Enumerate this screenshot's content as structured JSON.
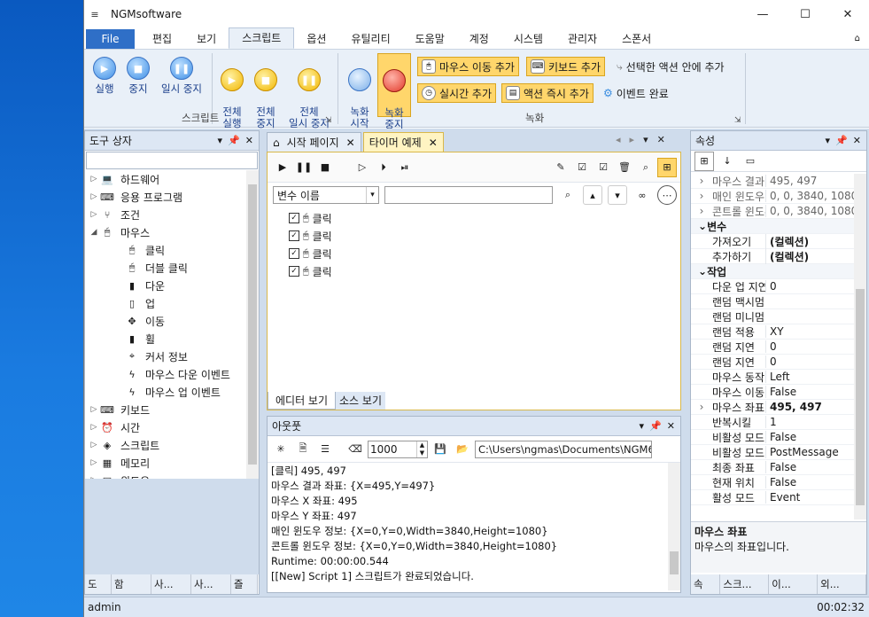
{
  "window": {
    "title": "NGMsoftware",
    "qa_icon": "≡",
    "min": "—",
    "max": "☐",
    "close": "✕"
  },
  "menu": {
    "file": "File",
    "items": [
      "편집",
      "보기",
      "스크립트",
      "옵션",
      "유틸리티",
      "도움말",
      "계정",
      "시스템",
      "관리자",
      "스폰서"
    ],
    "active": "스크립트"
  },
  "ribbon": {
    "run": "실행",
    "stop": "중지",
    "pause": "일시 중지",
    "all_run": "전체\n실행",
    "all_stop": "전체\n중지",
    "all_pause": "전체\n일시 중지",
    "group_script": "스크립트",
    "rec_start": "녹화\n시작",
    "rec_stop": "녹화\n중지",
    "mouse_move_add": "마우스 이동 추가",
    "keyboard_add": "키보드 추가",
    "add_in_selected": "선택한 액션 안에 추가",
    "realtime_add": "실시간 추가",
    "action_now_add": "액션 즉시 추가",
    "event_done": "이벤트 완료",
    "group_record": "녹화"
  },
  "toolbox": {
    "title": "도구 상자",
    "search_placeholder": "",
    "items": [
      {
        "label": "하드웨어",
        "icon": "laptop-icon",
        "level": 0,
        "arrow": "▷"
      },
      {
        "label": "응용 프로그램",
        "icon": "app-icon",
        "level": 0,
        "arrow": "▷"
      },
      {
        "label": "조건",
        "icon": "branch-icon",
        "level": 0,
        "arrow": "▷"
      },
      {
        "label": "마우스",
        "icon": "mouse-icon",
        "level": 0,
        "arrow": "◢"
      },
      {
        "label": "클릭",
        "icon": "click-icon",
        "level": 1,
        "arrow": ""
      },
      {
        "label": "더블 클릭",
        "icon": "double-click-icon",
        "level": 1,
        "arrow": ""
      },
      {
        "label": "다운",
        "icon": "mouse-down-icon",
        "level": 1,
        "arrow": ""
      },
      {
        "label": "업",
        "icon": "mouse-up-icon",
        "level": 1,
        "arrow": ""
      },
      {
        "label": "이동",
        "icon": "move-icon",
        "level": 1,
        "arrow": ""
      },
      {
        "label": "휠",
        "icon": "wheel-icon",
        "level": 1,
        "arrow": ""
      },
      {
        "label": "커서 정보",
        "icon": "cursor-icon",
        "level": 1,
        "arrow": ""
      },
      {
        "label": "마우스 다운 이벤트",
        "icon": "bolt-icon",
        "level": 1,
        "arrow": ""
      },
      {
        "label": "마우스 업 이벤트",
        "icon": "bolt-icon",
        "level": 1,
        "arrow": ""
      },
      {
        "label": "키보드",
        "icon": "keyboard-icon",
        "level": 0,
        "arrow": "▷"
      },
      {
        "label": "시간",
        "icon": "clock-icon",
        "level": 0,
        "arrow": "▷"
      },
      {
        "label": "스크립트",
        "icon": "script-icon",
        "level": 0,
        "arrow": "▷"
      },
      {
        "label": "메모리",
        "icon": "memory-icon",
        "level": 0,
        "arrow": "▷"
      },
      {
        "label": "윈도우",
        "icon": "window-icon",
        "level": 0,
        "arrow": "▷"
      }
    ],
    "bottom_tabs": [
      "도",
      "함",
      "사...",
      "사...",
      "즐"
    ]
  },
  "editor": {
    "tabs": [
      {
        "label": "시작 페이지"
      },
      {
        "label": "타이머 예제"
      }
    ],
    "var_select": "변수 이름",
    "var_input": "",
    "rows": [
      "클릭",
      "클릭",
      "클릭",
      "클릭"
    ],
    "view_tabs": [
      "에디터 보기",
      "소스 보기"
    ]
  },
  "output": {
    "title": "아웃풋",
    "count": "1000",
    "path": "C:\\Users\\ngmas\\Documents\\NGM6\\",
    "lines": [
      "[클릭] 495, 497",
      "마우스 결과 좌표: {X=495,Y=497}",
      "마우스 X 좌표: 495",
      "마우스 Y 좌표: 497",
      "매인 윈도우 정보: {X=0,Y=0,Width=3840,Height=1080}",
      "콘트롤 윈도우 정보: {X=0,Y=0,Width=3840,Height=1080}",
      "Runtime: 00:00:00.544",
      "[[New] Script 1] 스크립트가 완료되었습니다."
    ]
  },
  "properties": {
    "title": "속성",
    "rows": [
      {
        "type": "prop",
        "name": "마우스 결과",
        "value": "495, 497",
        "bold": false,
        "gray": true,
        "arrow": "›"
      },
      {
        "type": "prop",
        "name": "매인 윈도우",
        "value": "0, 0, 3840, 1080",
        "gray": true,
        "arrow": "›"
      },
      {
        "type": "prop",
        "name": "콘트롤 윈도우",
        "value": "0, 0, 3840, 1080",
        "gray": true,
        "arrow": "›"
      },
      {
        "type": "cat",
        "name": "변수"
      },
      {
        "type": "prop",
        "name": "가져오기",
        "value": "(컬렉션)",
        "bold": true
      },
      {
        "type": "prop",
        "name": "추가하기",
        "value": "(컬렉션)",
        "bold": true
      },
      {
        "type": "cat",
        "name": "작업"
      },
      {
        "type": "prop",
        "name": "다운 업 지연",
        "value": "0"
      },
      {
        "type": "prop",
        "name": "랜덤 맥시멈",
        "value": ""
      },
      {
        "type": "prop",
        "name": "랜덤 미니멈",
        "value": ""
      },
      {
        "type": "prop",
        "name": "랜덤 적용",
        "value": "XY"
      },
      {
        "type": "prop",
        "name": "랜덤 지연",
        "value": "0"
      },
      {
        "type": "prop",
        "name": "랜덤 지연",
        "value": "0"
      },
      {
        "type": "prop",
        "name": "마우스 동작",
        "value": "Left"
      },
      {
        "type": "prop",
        "name": "마우스 이동",
        "value": "False"
      },
      {
        "type": "prop",
        "name": "마우스 좌표",
        "value": "495, 497",
        "bold": true,
        "arrow": "›"
      },
      {
        "type": "prop",
        "name": "반복시킬",
        "value": "1"
      },
      {
        "type": "prop",
        "name": "비활성 모드",
        "value": "False"
      },
      {
        "type": "prop",
        "name": "비활성 모드",
        "value": "PostMessage"
      },
      {
        "type": "prop",
        "name": "최종 좌표",
        "value": "False"
      },
      {
        "type": "prop",
        "name": "현재 위치",
        "value": "False"
      },
      {
        "type": "prop",
        "name": "활성 모드",
        "value": "Event"
      }
    ],
    "desc_title": "마우스 좌표",
    "desc_text": "마우스의 좌표입니다.",
    "bottom_tabs": [
      "속",
      "스크...",
      "이...",
      "외..."
    ]
  },
  "status": {
    "user": "admin",
    "time": "00:02:32"
  }
}
